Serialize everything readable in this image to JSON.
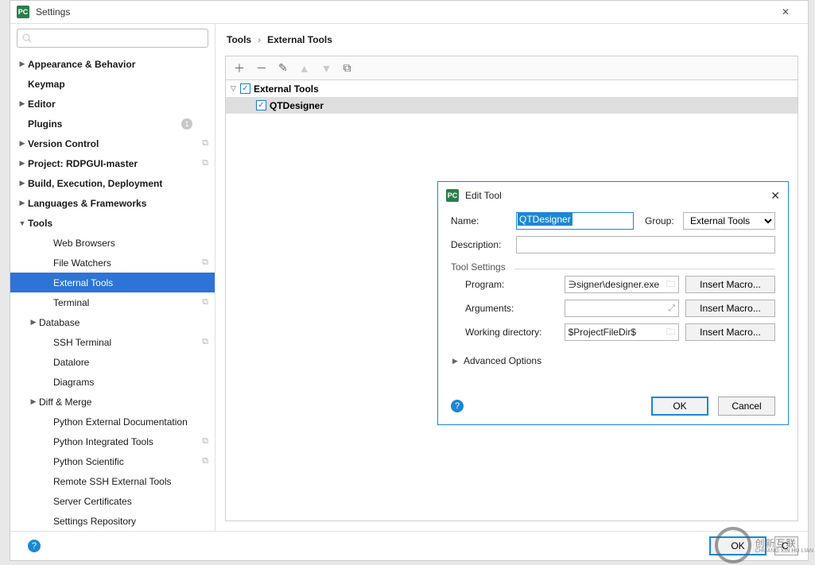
{
  "window": {
    "title": "Settings"
  },
  "search": {
    "placeholder": ""
  },
  "tree": [
    {
      "label": "Appearance & Behavior",
      "bold": true,
      "arrow": "▶",
      "level": 0
    },
    {
      "label": "Keymap",
      "bold": true,
      "arrow": "",
      "level": 0
    },
    {
      "label": "Editor",
      "bold": true,
      "arrow": "▶",
      "level": 0
    },
    {
      "label": "Plugins",
      "bold": true,
      "arrow": "",
      "level": 0,
      "badge": "1"
    },
    {
      "label": "Version Control",
      "bold": true,
      "arrow": "▶",
      "level": 0,
      "copy": true
    },
    {
      "label": "Project: RDPGUI-master",
      "bold": true,
      "arrow": "▶",
      "level": 0,
      "copy": true
    },
    {
      "label": "Build, Execution, Deployment",
      "bold": true,
      "arrow": "▶",
      "level": 0
    },
    {
      "label": "Languages & Frameworks",
      "bold": true,
      "arrow": "▶",
      "level": 0
    },
    {
      "label": "Tools",
      "bold": true,
      "arrow": "▼",
      "level": 0
    },
    {
      "label": "Web Browsers",
      "arrow": "",
      "level": 2
    },
    {
      "label": "File Watchers",
      "arrow": "",
      "level": 2,
      "copy": true
    },
    {
      "label": "External Tools",
      "arrow": "",
      "level": 2,
      "selected": true
    },
    {
      "label": "Terminal",
      "arrow": "",
      "level": 2,
      "copy": true
    },
    {
      "label": "Database",
      "arrow": "▶",
      "level": 1
    },
    {
      "label": "SSH Terminal",
      "arrow": "",
      "level": 2,
      "copy": true
    },
    {
      "label": "Datalore",
      "arrow": "",
      "level": 2
    },
    {
      "label": "Diagrams",
      "arrow": "",
      "level": 2
    },
    {
      "label": "Diff & Merge",
      "arrow": "▶",
      "level": 1
    },
    {
      "label": "Python External Documentation",
      "arrow": "",
      "level": 2
    },
    {
      "label": "Python Integrated Tools",
      "arrow": "",
      "level": 2,
      "copy": true
    },
    {
      "label": "Python Scientific",
      "arrow": "",
      "level": 2,
      "copy": true
    },
    {
      "label": "Remote SSH External Tools",
      "arrow": "",
      "level": 2
    },
    {
      "label": "Server Certificates",
      "arrow": "",
      "level": 2
    },
    {
      "label": "Settings Repository",
      "arrow": "",
      "level": 2
    }
  ],
  "breadcrumb": {
    "a": "Tools",
    "b": "External Tools"
  },
  "list": {
    "group": "External Tools",
    "item": "QTDesigner"
  },
  "dialog": {
    "title": "Edit Tool",
    "name_label": "Name:",
    "name_value": "QTDesigner",
    "group_label": "Group:",
    "group_value": "External Tools",
    "desc_label": "Description:",
    "desc_value": "",
    "section": "Tool Settings",
    "program_label": "Program:",
    "program_value": "∋signer\\designer.exe",
    "args_label": "Arguments:",
    "args_value": "",
    "wd_label": "Working directory:",
    "wd_value": "$ProjectFileDir$",
    "macro_btn": "Insert Macro...",
    "advanced": "Advanced Options",
    "ok": "OK",
    "cancel": "Cancel"
  },
  "footer": {
    "ok": "OK",
    "cancel": "C"
  },
  "watermark": {
    "main": "创新互联",
    "sub": "CHUANG XIN HU LIAN"
  }
}
